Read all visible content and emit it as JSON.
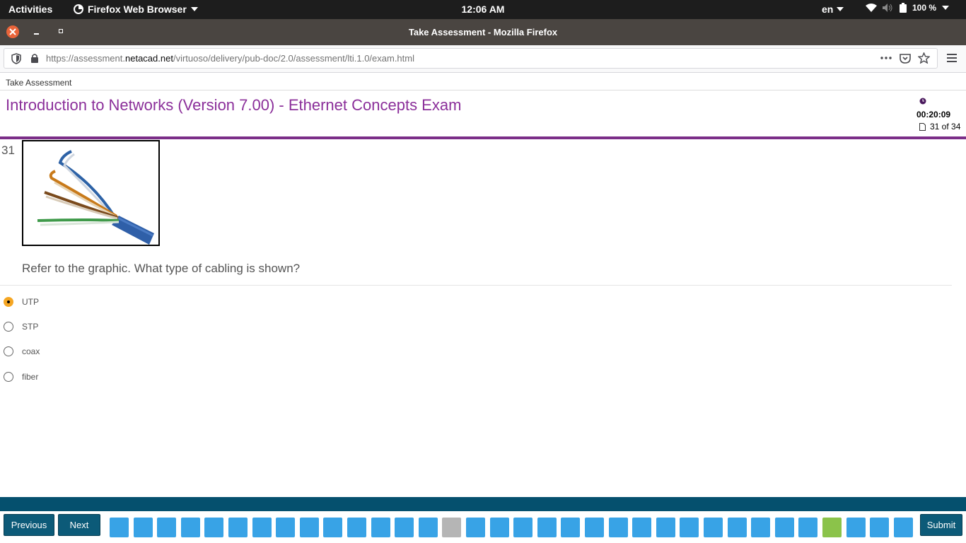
{
  "system_bar": {
    "activities": "Activities",
    "app_name": "Firefox Web Browser",
    "clock": "12:06 AM",
    "language": "en",
    "battery": "100 %"
  },
  "window": {
    "title": "Take Assessment - Mozilla Firefox"
  },
  "browser": {
    "url_prefix": "https://assessment.",
    "url_domain": "netacad.net",
    "url_path": "/virtuoso/delivery/pub-doc/2.0/assessment/lti.1.0/exam.html"
  },
  "page": {
    "breadcrumb": "Take Assessment",
    "exam_title": "Introduction to Networks (Version 7.00) - Ethernet Concepts Exam",
    "timer": "00:20:09",
    "question_count": "31 of 34"
  },
  "question": {
    "number": "31",
    "text": "Refer to the graphic. What type of cabling is shown?",
    "options": [
      {
        "label": "UTP",
        "selected": true
      },
      {
        "label": "STP",
        "selected": false
      },
      {
        "label": "coax",
        "selected": false
      },
      {
        "label": "fiber",
        "selected": false
      }
    ]
  },
  "footer": {
    "previous_label": "Previous",
    "next_label": "Next",
    "submit_label": "Submit",
    "question_buttons": [
      "answered",
      "answered",
      "answered",
      "answered",
      "answered",
      "answered",
      "answered",
      "answered",
      "answered",
      "answered",
      "answered",
      "answered",
      "answered",
      "answered",
      "unanswered",
      "answered",
      "answered",
      "answered",
      "answered",
      "answered",
      "answered",
      "answered",
      "answered",
      "answered",
      "answered",
      "answered",
      "answered",
      "answered",
      "answered",
      "answered",
      "current",
      "answered",
      "answered",
      "answered"
    ],
    "colors": {
      "answered": "#38a3e6",
      "unanswered": "#b5b5b5",
      "current": "#8bc34a"
    }
  }
}
